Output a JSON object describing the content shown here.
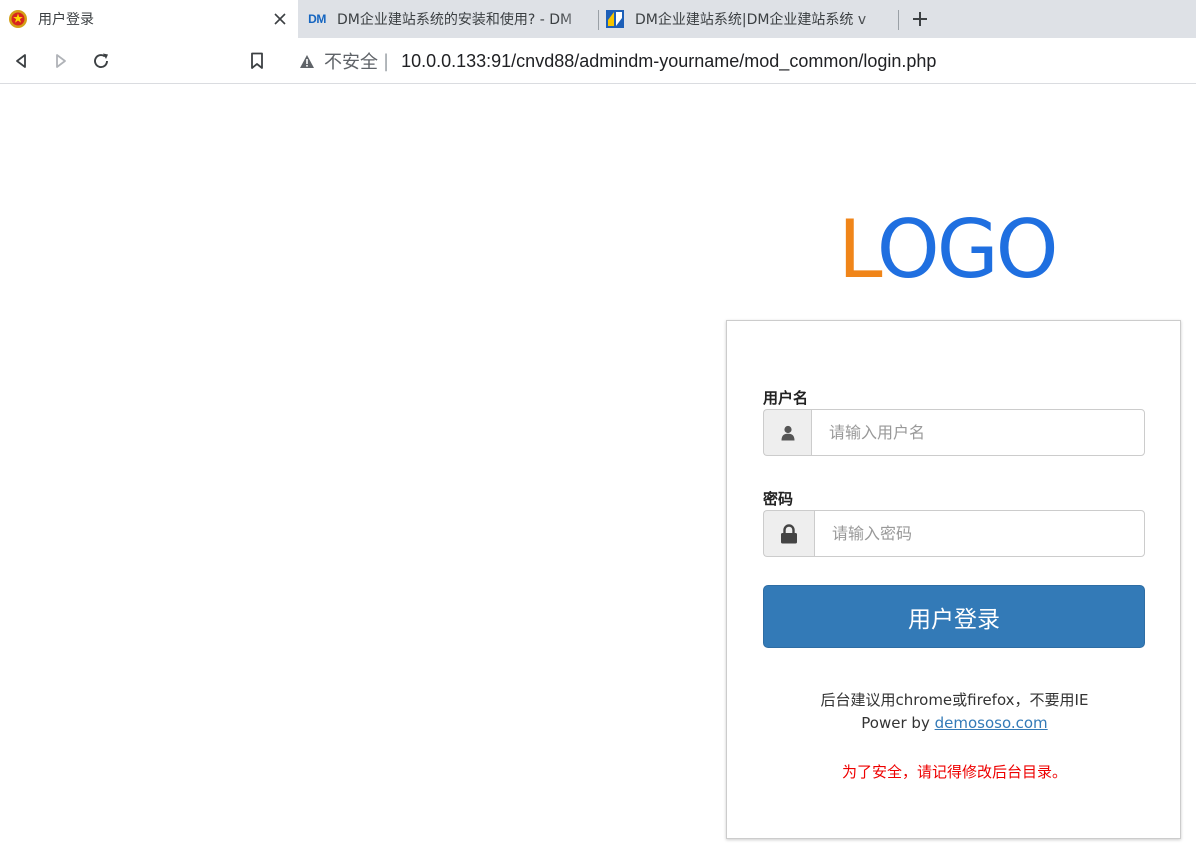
{
  "browser": {
    "tabs": [
      {
        "title": "用户登录",
        "favicon": "emblem-icon",
        "active": true
      },
      {
        "title": "DM企业建站系统的安装和使用? - DM",
        "favicon": "dm-icon",
        "favicon_text": "DM"
      },
      {
        "title": "DM企业建站系统|DM企业建站系统 v",
        "favicon": "dm-square-icon"
      }
    ],
    "address": {
      "security_label": "不安全",
      "separator": "|",
      "url": "10.0.0.133:91/cnvd88/admindm-yourname/mod_common/login.php"
    }
  },
  "page": {
    "logo": {
      "first": "L",
      "rest": "OGO"
    },
    "form": {
      "username_label": "用户名",
      "username_placeholder": "请输入用户名",
      "username_value": "",
      "password_label": "密码",
      "password_placeholder": "请输入密码",
      "password_value": "",
      "submit_label": "用户登录"
    },
    "footer": {
      "browser_tip": "后台建议用chrome或firefox，不要用IE",
      "power_prefix": "Power by",
      "power_link": "demososo.com",
      "security_tip": "为了安全，请记得修改后台目录。"
    }
  },
  "colors": {
    "logo_orange": "#f08519",
    "logo_blue": "#1f6fe0",
    "button_primary": "#337ab7",
    "warning_red": "#e00000"
  }
}
